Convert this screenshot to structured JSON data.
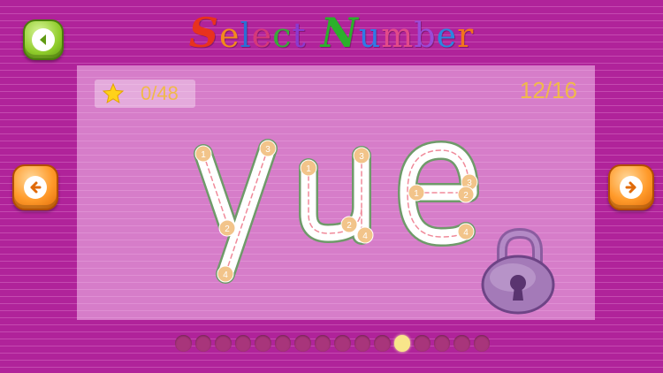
{
  "title": {
    "letters": [
      {
        "char": "S",
        "color": "#e8321e",
        "big": true
      },
      {
        "char": "e",
        "color": "#f28a1c",
        "big": false
      },
      {
        "char": "l",
        "color": "#2a6fd6",
        "big": false
      },
      {
        "char": "e",
        "color": "#d6387a",
        "big": false
      },
      {
        "char": "c",
        "color": "#3aa83a",
        "big": false
      },
      {
        "char": "t",
        "color": "#8a3ad0",
        "big": false
      },
      {
        "char": " ",
        "color": "#000000",
        "big": false
      },
      {
        "char": "N",
        "color": "#2bb02b",
        "big": true
      },
      {
        "char": "u",
        "color": "#2f7ae6",
        "big": false
      },
      {
        "char": "m",
        "color": "#e24a8a",
        "big": false
      },
      {
        "char": "b",
        "color": "#9a4ad8",
        "big": false
      },
      {
        "char": "e",
        "color": "#2a86e0",
        "big": false
      },
      {
        "char": "r",
        "color": "#f2741c",
        "big": false
      }
    ]
  },
  "score": {
    "stars": "0/48"
  },
  "progress": "12/16",
  "word": "yue",
  "stroke_markers": {
    "y": [
      "1",
      "3",
      "2",
      "4"
    ],
    "u": [
      "1",
      "3",
      "2",
      "4"
    ],
    "e": [
      "1",
      "3",
      "2",
      "4"
    ]
  },
  "pager": {
    "total": 16,
    "current": 12
  },
  "icons": {
    "back": "back-arrow-icon",
    "prev": "left-arrow-icon",
    "next": "right-arrow-icon",
    "star": "star-icon",
    "lock": "padlock-icon"
  },
  "colors": {
    "background": "#b0239a",
    "accent_text": "#f0b94a",
    "letter_outline": "#6f9a6a",
    "marker": "#f2c48a",
    "active_dot": "#f8e58a"
  }
}
